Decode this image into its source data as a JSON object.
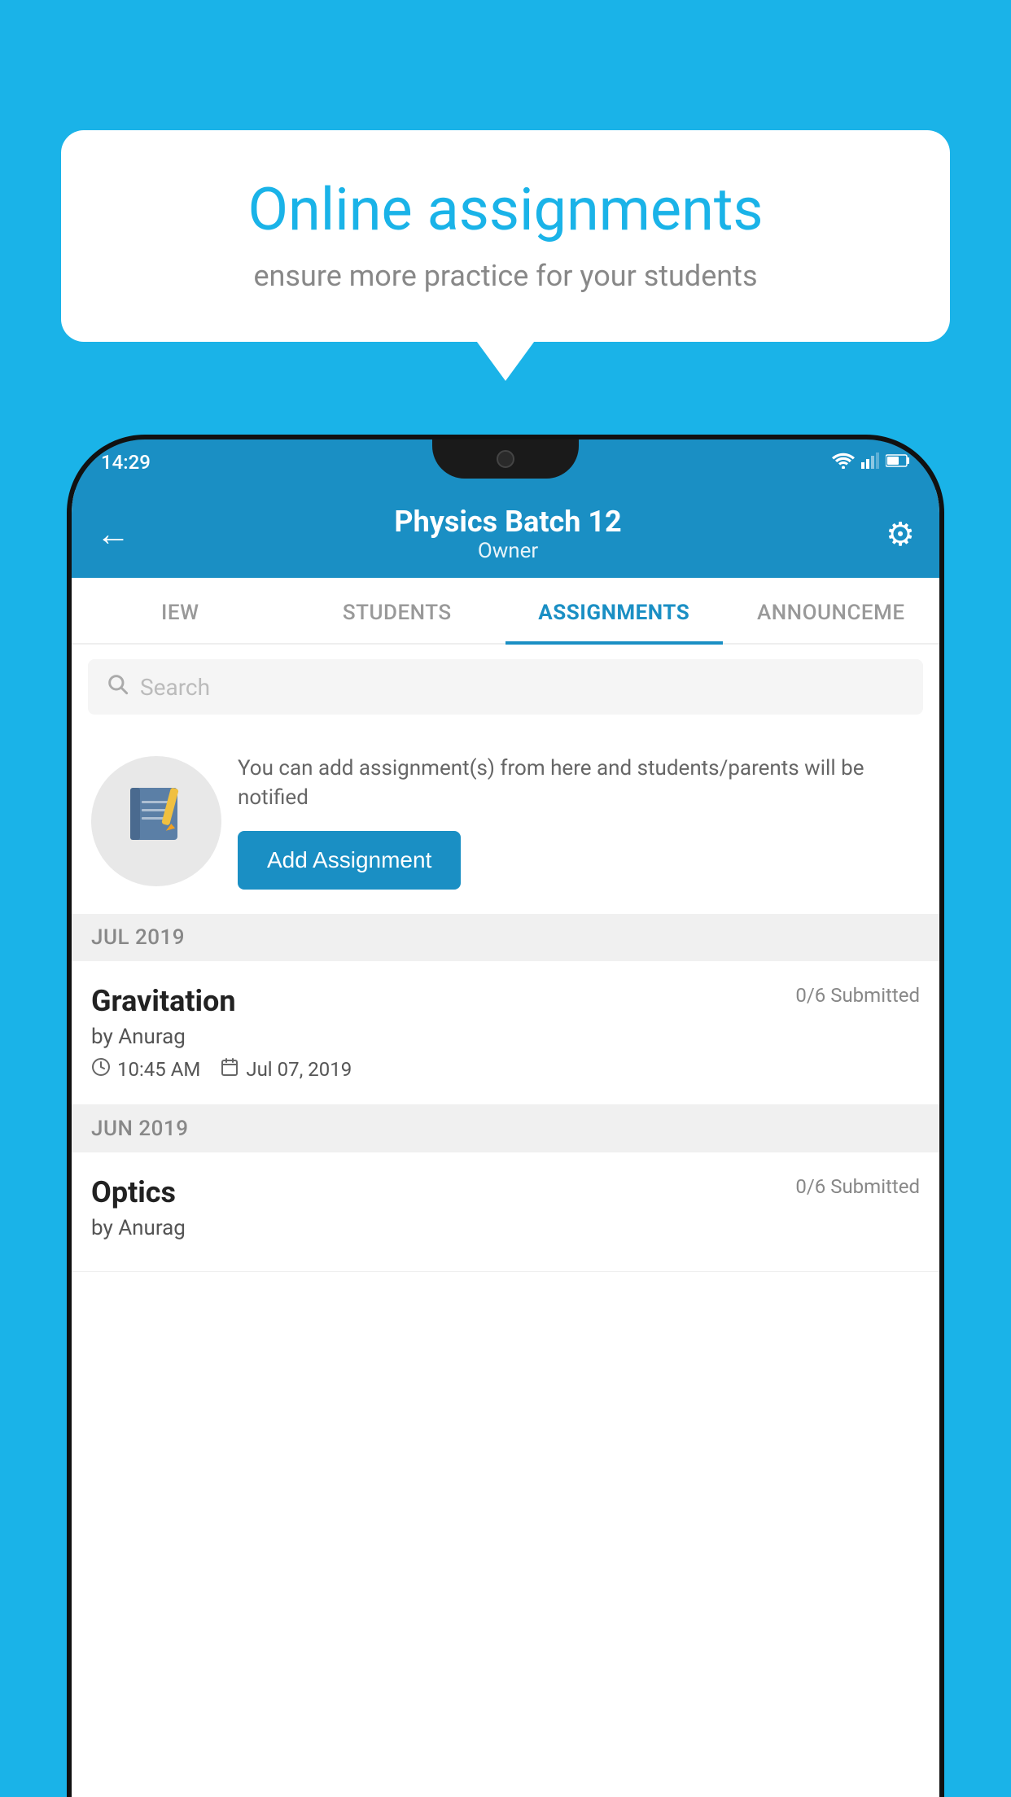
{
  "background_color": "#1ab3e8",
  "speech_bubble": {
    "title": "Online assignments",
    "subtitle": "ensure more practice for your students"
  },
  "phone": {
    "status_bar": {
      "time": "14:29"
    },
    "header": {
      "title": "Physics Batch 12",
      "subtitle": "Owner",
      "back_label": "←",
      "gear_label": "⚙"
    },
    "tabs": [
      {
        "label": "IEW",
        "active": false
      },
      {
        "label": "STUDENTS",
        "active": false
      },
      {
        "label": "ASSIGNMENTS",
        "active": true
      },
      {
        "label": "ANNOUNCEME",
        "active": false
      }
    ],
    "search": {
      "placeholder": "Search"
    },
    "promo": {
      "text": "You can add assignment(s) from here and students/parents will be notified",
      "button_label": "Add Assignment"
    },
    "sections": [
      {
        "month_label": "JUL 2019",
        "assignments": [
          {
            "name": "Gravitation",
            "submitted": "0/6 Submitted",
            "by": "by Anurag",
            "time": "10:45 AM",
            "date": "Jul 07, 2019"
          }
        ]
      },
      {
        "month_label": "JUN 2019",
        "assignments": [
          {
            "name": "Optics",
            "submitted": "0/6 Submitted",
            "by": "by Anurag",
            "time": "",
            "date": ""
          }
        ]
      }
    ]
  }
}
